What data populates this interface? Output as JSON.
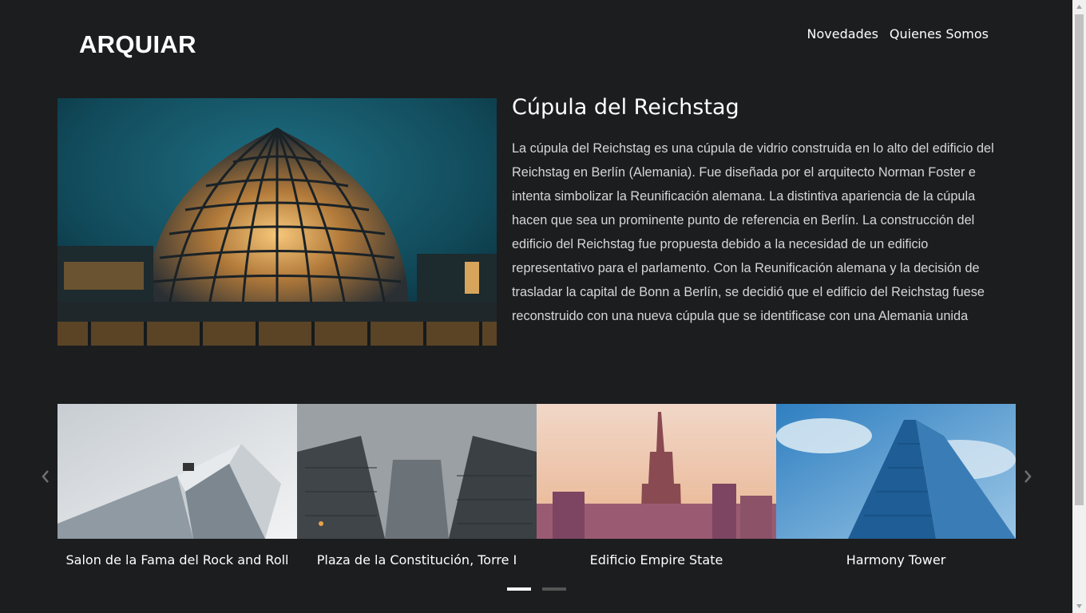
{
  "header": {
    "logo": "ARQUIAR",
    "nav": [
      "Novedades",
      "Quienes Somos"
    ]
  },
  "featured": {
    "title": "Cúpula del Reichstag",
    "description": "La cúpula del Reichstag es una cúpula de vidrio construida en lo alto del edificio del Reichstag en Berlín (Alemania). Fue diseñada por el arquitecto Norman Foster e intenta simbolizar la Reunificación alemana. La distintiva apariencia de la cúpula hacen que sea un prominente punto de referencia en Berlín. La construcción del edificio del Reichstag fue propuesta debido a la necesidad de un edificio representativo para el parlamento. Con la Reunificación alemana y la decisión de trasladar la capital de Bonn a Berlín, se decidió que el edificio del Reichstag fuese reconstruido con una nueva cúpula que se identificase con una Alemania unida"
  },
  "carousel": {
    "items": [
      {
        "caption": "Salon de la Fama del Rock and Roll"
      },
      {
        "caption": "Plaza de la Constitución, Torre I"
      },
      {
        "caption": "Edificio Empire State"
      },
      {
        "caption": "Harmony Tower"
      }
    ],
    "indicator_count": 2,
    "active_indicator": 1
  },
  "colors": {
    "background": "#1c1d1f",
    "text": "#ffffff",
    "indicator_active": "#ffffff",
    "indicator_inactive": "#555555"
  }
}
